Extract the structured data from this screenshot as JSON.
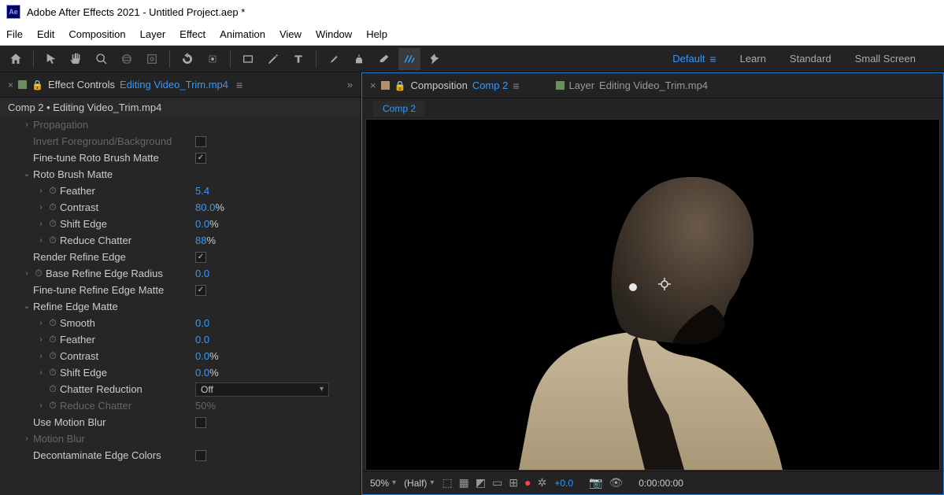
{
  "titlebar": {
    "text": "Adobe After Effects 2021 - Untitled Project.aep *",
    "logo": "Ae"
  },
  "menubar": [
    "File",
    "Edit",
    "Composition",
    "Layer",
    "Effect",
    "Animation",
    "View",
    "Window",
    "Help"
  ],
  "workspaces": {
    "active": "Default",
    "items": [
      "Default",
      "Learn",
      "Standard",
      "Small Screen"
    ]
  },
  "left_panel": {
    "tab_prefix": "Effect Controls",
    "tab_file": "Editing Video_Trim.mp4",
    "subhead": "Comp 2 • Editing Video_Trim.mp4",
    "params": [
      {
        "indent": 1,
        "arrow": ">",
        "label": "Propagation",
        "type": "none",
        "dim": true
      },
      {
        "indent": 1,
        "arrow": "",
        "label": "Invert Foreground/Background",
        "type": "check",
        "checked": false,
        "dim": true
      },
      {
        "indent": 1,
        "arrow": "",
        "label": "Fine-tune Roto Brush Matte",
        "type": "check",
        "checked": true
      },
      {
        "indent": 1,
        "arrow": "v",
        "label": "Roto Brush Matte",
        "type": "none"
      },
      {
        "indent": 2,
        "arrow": ">",
        "sw": true,
        "label": "Feather",
        "type": "value",
        "value": "5.4"
      },
      {
        "indent": 2,
        "arrow": ">",
        "sw": true,
        "label": "Contrast",
        "type": "value",
        "value": "80.0",
        "suffix": "%"
      },
      {
        "indent": 2,
        "arrow": ">",
        "sw": true,
        "label": "Shift Edge",
        "type": "value",
        "value": "0.0",
        "suffix": "%"
      },
      {
        "indent": 2,
        "arrow": ">",
        "sw": true,
        "label": "Reduce Chatter",
        "type": "value",
        "value": "88",
        "suffix": "%"
      },
      {
        "indent": 1,
        "arrow": "",
        "label": "Render Refine Edge",
        "type": "check",
        "checked": true
      },
      {
        "indent": 1,
        "arrow": ">",
        "sw": true,
        "label": "Base Refine Edge Radius",
        "type": "value",
        "value": "0.0"
      },
      {
        "indent": 1,
        "arrow": "",
        "label": "Fine-tune Refine Edge Matte",
        "type": "check",
        "checked": true
      },
      {
        "indent": 1,
        "arrow": "v",
        "label": "Refine Edge Matte",
        "type": "none"
      },
      {
        "indent": 2,
        "arrow": ">",
        "sw": true,
        "label": "Smooth",
        "type": "value",
        "value": "0.0"
      },
      {
        "indent": 2,
        "arrow": ">",
        "sw": true,
        "label": "Feather",
        "type": "value",
        "value": "0.0"
      },
      {
        "indent": 2,
        "arrow": ">",
        "sw": true,
        "label": "Contrast",
        "type": "value",
        "value": "0.0",
        "suffix": "%"
      },
      {
        "indent": 2,
        "arrow": ">",
        "sw": true,
        "label": "Shift Edge",
        "type": "value",
        "value": "0.0",
        "suffix": "%"
      },
      {
        "indent": 2,
        "arrow": "",
        "sw": true,
        "label": "Chatter Reduction",
        "type": "select",
        "value": "Off"
      },
      {
        "indent": 2,
        "arrow": ">",
        "sw": true,
        "label": "Reduce Chatter",
        "type": "value",
        "value": "50",
        "suffix": "%",
        "dim": true
      },
      {
        "indent": 1,
        "arrow": "",
        "label": "Use Motion Blur",
        "type": "check",
        "checked": false
      },
      {
        "indent": 1,
        "arrow": ">",
        "label": "Motion Blur",
        "type": "none",
        "dim": true
      },
      {
        "indent": 1,
        "arrow": "",
        "label": "Decontaminate Edge Colors",
        "type": "check",
        "checked": false
      }
    ]
  },
  "right_panel": {
    "tab1_prefix": "Composition",
    "tab1_link": "Comp 2",
    "tab2_prefix": "Layer",
    "tab2_file": "Editing Video_Trim.mp4",
    "comptab": "Comp 2"
  },
  "viewer_bar": {
    "zoom": "50%",
    "res": "(Half)",
    "exposure": "+0.0",
    "timecode": "0:00:00:00"
  }
}
